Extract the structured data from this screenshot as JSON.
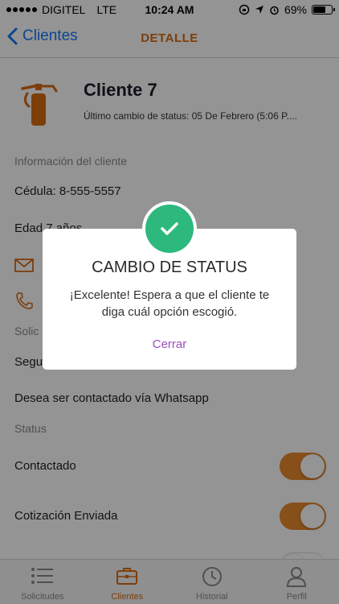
{
  "status_bar": {
    "carrier": "DIGITEL",
    "network": "LTE",
    "time": "10:24 AM",
    "battery": "69%",
    "battery_level": 0.69
  },
  "nav": {
    "back_label": "Clientes",
    "title": "DETALLE"
  },
  "client": {
    "name": "Cliente 7",
    "status_change": "Último cambio de status: 05 De Febrero (5:06 P...."
  },
  "info": {
    "section_label": "Información del cliente",
    "cedula": "Cédula: 8-555-5557",
    "edad": "Edad 7 años"
  },
  "solicitud": {
    "section_label": "Solic",
    "seguro": "Segu",
    "whatsapp": "Desea ser contactado vía Whatsapp"
  },
  "status_section": {
    "label": "Status",
    "items": [
      {
        "label": "Contactado",
        "on": true
      },
      {
        "label": "Cotización Enviada",
        "on": true
      }
    ]
  },
  "tabs": [
    {
      "label": "Solicitudes",
      "icon": "list-icon"
    },
    {
      "label": "Clientes",
      "icon": "briefcase-icon",
      "active": true
    },
    {
      "label": "Historial",
      "icon": "clock-icon"
    },
    {
      "label": "Perfil",
      "icon": "person-icon"
    }
  ],
  "modal": {
    "title": "CAMBIO DE STATUS",
    "message": "¡Excelente! Espera a que el cliente te diga cuál opción escogió.",
    "button": "Cerrar"
  },
  "colors": {
    "accent_orange": "#d76b12",
    "link_blue": "#1578f5",
    "success_green": "#2db87d",
    "modal_button_purple": "#9a4fc0"
  }
}
